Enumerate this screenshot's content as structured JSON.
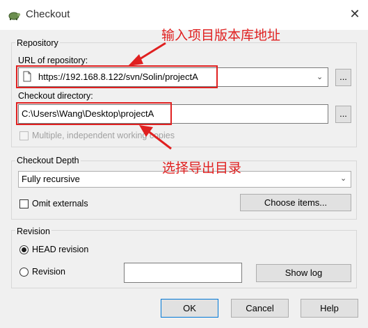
{
  "window": {
    "title": "Checkout",
    "app_icon": "tortoise-icon",
    "close_glyph": "✕"
  },
  "repository": {
    "group_label": "Repository",
    "url_label": "URL of repository:",
    "url_value": "https://192.168.8.122/svn/Solin/projectA",
    "browse_label": "...",
    "dir_label": "Checkout directory:",
    "dir_value": "C:\\Users\\Wang\\Desktop\\projectA",
    "dir_browse_label": "...",
    "multiple_label": "Multiple, independent working copies"
  },
  "depth": {
    "group_label": "Checkout Depth",
    "selected": "Fully recursive",
    "omit_externals_label": "Omit externals",
    "choose_items_label": "Choose items..."
  },
  "revision": {
    "group_label": "Revision",
    "head_label": "HEAD revision",
    "revision_label": "Revision",
    "revision_value": "",
    "show_log_label": "Show log"
  },
  "buttons": {
    "ok": "OK",
    "cancel": "Cancel",
    "help": "Help"
  },
  "annotations": {
    "url_note": "输入项目版本库地址",
    "dir_note": "选择导出目录",
    "color": "#e02020"
  }
}
